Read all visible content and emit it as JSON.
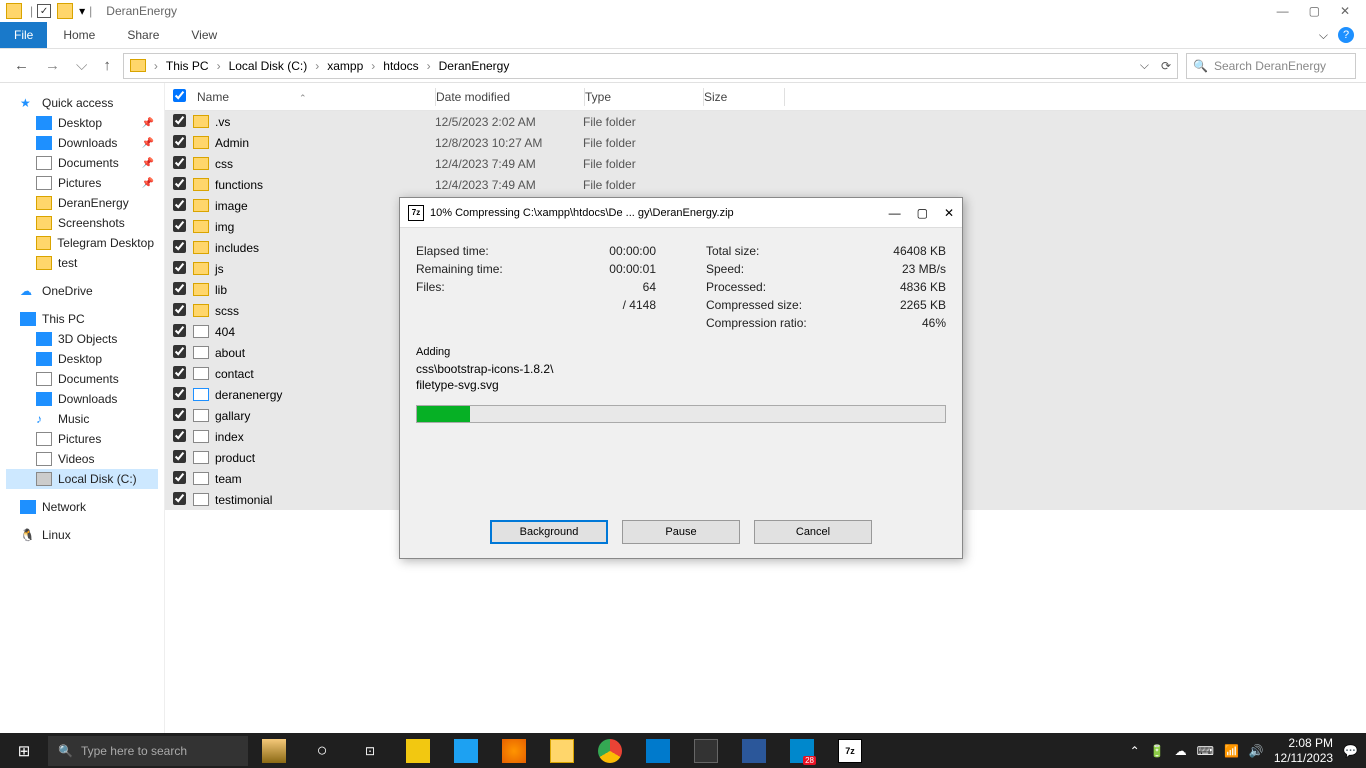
{
  "window": {
    "title": "DeranEnergy",
    "minimize": "—",
    "maximize": "▢",
    "close": "✕"
  },
  "ribbon": {
    "file": "File",
    "tabs": [
      "Home",
      "Share",
      "View"
    ]
  },
  "breadcrumb": {
    "items": [
      "This PC",
      "Local Disk (C:)",
      "xampp",
      "htdocs",
      "DeranEnergy"
    ]
  },
  "search": {
    "placeholder": "Search DeranEnergy"
  },
  "sidebar": {
    "quick": {
      "label": "Quick access"
    },
    "quick_items": [
      {
        "label": "Desktop",
        "pin": true
      },
      {
        "label": "Downloads",
        "pin": true
      },
      {
        "label": "Documents",
        "pin": true
      },
      {
        "label": "Pictures",
        "pin": true
      },
      {
        "label": "DeranEnergy"
      },
      {
        "label": "Screenshots"
      },
      {
        "label": "Telegram Desktop"
      },
      {
        "label": "test"
      }
    ],
    "onedrive": "OneDrive",
    "thispc": "This PC",
    "thispc_items": [
      "3D Objects",
      "Desktop",
      "Documents",
      "Downloads",
      "Music",
      "Pictures",
      "Videos",
      "Local Disk (C:)"
    ],
    "network": "Network",
    "linux": "Linux"
  },
  "columns": {
    "name": "Name",
    "date": "Date modified",
    "type": "Type",
    "size": "Size"
  },
  "files": [
    {
      "name": ".vs",
      "date": "12/5/2023 2:02 AM",
      "type": "File folder",
      "kind": "folder"
    },
    {
      "name": "Admin",
      "date": "12/8/2023 10:27 AM",
      "type": "File folder",
      "kind": "folder"
    },
    {
      "name": "css",
      "date": "12/4/2023 7:49 AM",
      "type": "File folder",
      "kind": "folder"
    },
    {
      "name": "functions",
      "date": "12/4/2023 7:49 AM",
      "type": "File folder",
      "kind": "folder"
    },
    {
      "name": "image",
      "date": "",
      "type": "",
      "kind": "folder"
    },
    {
      "name": "img",
      "date": "",
      "type": "",
      "kind": "folder"
    },
    {
      "name": "includes",
      "date": "",
      "type": "",
      "kind": "folder"
    },
    {
      "name": "js",
      "date": "",
      "type": "",
      "kind": "folder"
    },
    {
      "name": "lib",
      "date": "",
      "type": "",
      "kind": "folder"
    },
    {
      "name": "scss",
      "date": "",
      "type": "",
      "kind": "folder"
    },
    {
      "name": "404",
      "date": "",
      "type": "",
      "kind": "php"
    },
    {
      "name": "about",
      "date": "",
      "type": "",
      "kind": "php"
    },
    {
      "name": "contact",
      "date": "",
      "type": "",
      "kind": "php"
    },
    {
      "name": "deranenergy",
      "date": "",
      "type": "",
      "kind": "html"
    },
    {
      "name": "gallary",
      "date": "",
      "type": "",
      "kind": "php"
    },
    {
      "name": "index",
      "date": "",
      "type": "",
      "kind": "php"
    },
    {
      "name": "product",
      "date": "",
      "type": "",
      "kind": "php"
    },
    {
      "name": "team",
      "date": "",
      "type": "",
      "kind": "php"
    },
    {
      "name": "testimonial",
      "date": "",
      "type": "",
      "kind": "php"
    }
  ],
  "dialog": {
    "title": "10% Compressing C:\\xampp\\htdocs\\De ... gy\\DeranEnergy.zip",
    "labels": {
      "elapsed": "Elapsed time:",
      "remaining": "Remaining time:",
      "files": "Files:",
      "total": "Total size:",
      "speed": "Speed:",
      "processed": "Processed:",
      "compressed": "Compressed size:",
      "ratio": "Compression ratio:",
      "adding": "Adding"
    },
    "vals": {
      "elapsed": "00:00:00",
      "remaining": "00:00:01",
      "files": "64",
      "files_total": "/ 4148",
      "total": "46408 KB",
      "speed": "23 MB/s",
      "processed": "4836 KB",
      "compressed": "2265 KB",
      "ratio": "46%"
    },
    "current_file_1": "css\\bootstrap-icons-1.8.2\\",
    "current_file_2": "filetype-svg.svg",
    "progress_pct": 10,
    "buttons": {
      "background": "Background",
      "pause": "Pause",
      "cancel": "Cancel"
    }
  },
  "taskbar": {
    "search": "Type here to search",
    "badge": "28",
    "time": "2:08 PM",
    "date": "12/11/2023"
  }
}
